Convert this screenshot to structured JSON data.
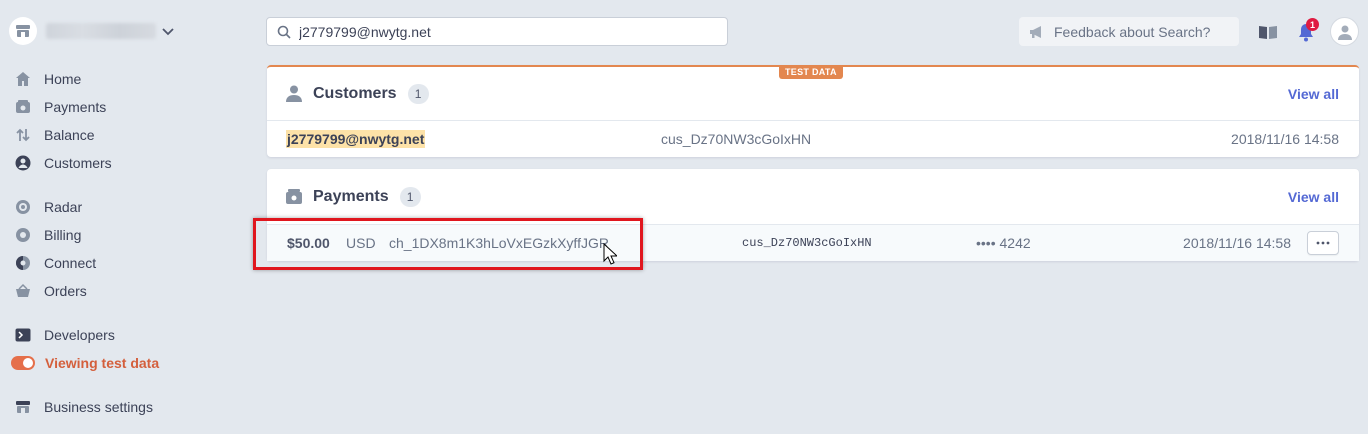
{
  "sidebar": {
    "nav_group_1": [
      {
        "label": "Home",
        "icon": "home-icon"
      },
      {
        "label": "Payments",
        "icon": "payments-icon"
      },
      {
        "label": "Balance",
        "icon": "balance-icon"
      },
      {
        "label": "Customers",
        "icon": "customers-icon"
      }
    ],
    "nav_group_2": [
      {
        "label": "Radar",
        "icon": "radar-icon"
      },
      {
        "label": "Billing",
        "icon": "billing-icon"
      },
      {
        "label": "Connect",
        "icon": "connect-icon"
      },
      {
        "label": "Orders",
        "icon": "orders-icon"
      }
    ],
    "developers": "Developers",
    "test_data": "Viewing test data",
    "business_settings": "Business settings"
  },
  "search": {
    "value": "j2779799@nwytg.net"
  },
  "feedback": {
    "label": "Feedback about Search?"
  },
  "notifications": {
    "count": "1"
  },
  "test_badge": "TEST DATA",
  "customers": {
    "title": "Customers",
    "count": "1",
    "view_all": "View all",
    "rows": [
      {
        "email": "j2779799@nwytg.net",
        "id": "cus_Dz70NW3cGoIxHN",
        "date": "2018/11/16 14:58"
      }
    ]
  },
  "payments": {
    "title": "Payments",
    "count": "1",
    "view_all": "View all",
    "rows": [
      {
        "amount": "$50.00",
        "currency": "USD",
        "charge_id": "ch_1DX8m1K3hLoVxEGzkXyffJGR",
        "customer": "cus_Dz70NW3cGoIxHN",
        "card": "•••• 4242",
        "date": "2018/11/16 14:58"
      }
    ]
  },
  "colors": {
    "accent": "#5469d4",
    "test": "#e3874f",
    "highlight": "#e0161e"
  }
}
